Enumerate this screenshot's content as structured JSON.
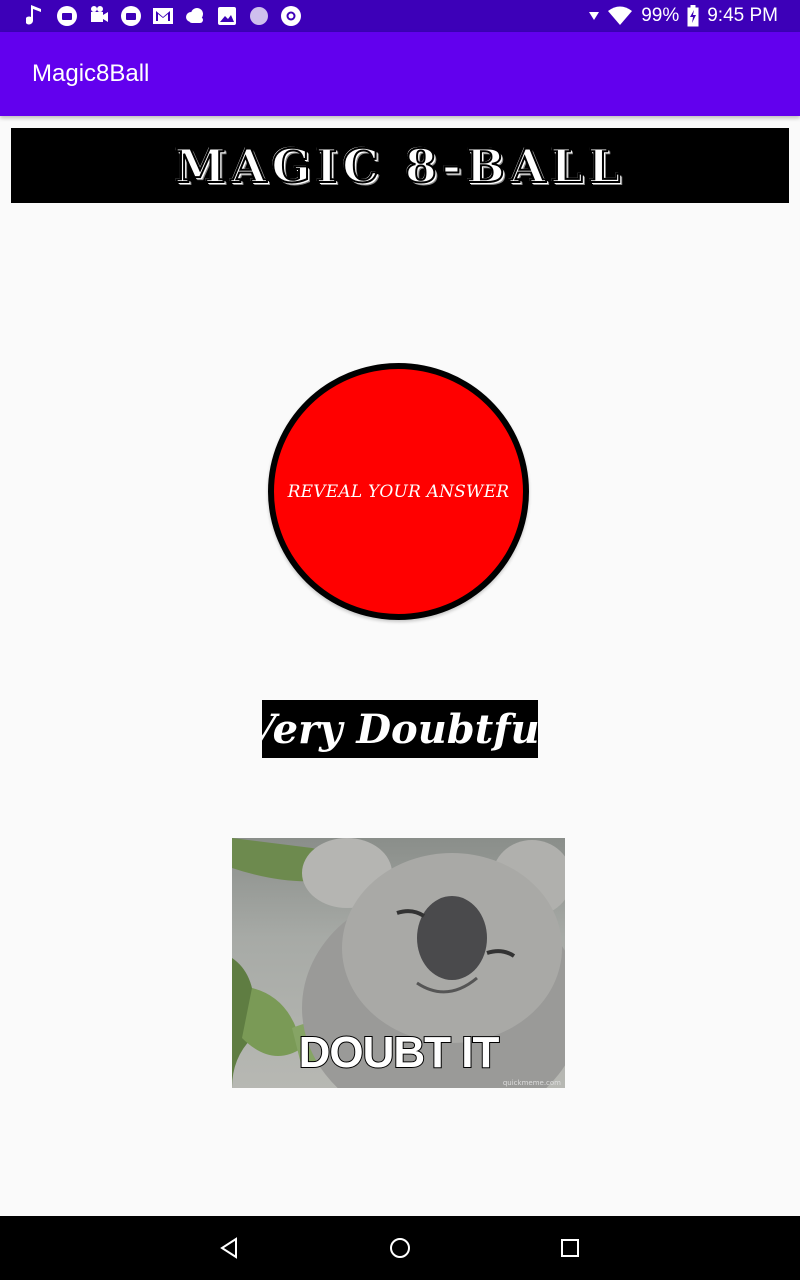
{
  "status_bar": {
    "battery": "99%",
    "time": "9:45 PM",
    "icons_left": [
      "music-note-icon",
      "android-notification-icon",
      "video-camera-icon",
      "android-notification-icon",
      "gmail-icon",
      "weather-cloud-icon",
      "image-icon",
      "circle-icon",
      "chrome-icon"
    ],
    "icons_right": [
      "signal-arrow-icon",
      "wifi-icon",
      "battery-icon"
    ]
  },
  "app_bar": {
    "title": "Magic8Ball",
    "color": "#6200ee"
  },
  "banner": {
    "title": "MAGIC 8-BALL"
  },
  "reveal_button": {
    "label": "REVEAL YOUR ANSWER",
    "color": "#ff0000"
  },
  "answer": {
    "text": "Very Doubtful"
  },
  "meme": {
    "caption": "DOUBT IT",
    "watermark": "quickmeme.com"
  },
  "nav_bar": {
    "buttons": [
      "back-icon",
      "home-icon",
      "recents-icon"
    ]
  }
}
